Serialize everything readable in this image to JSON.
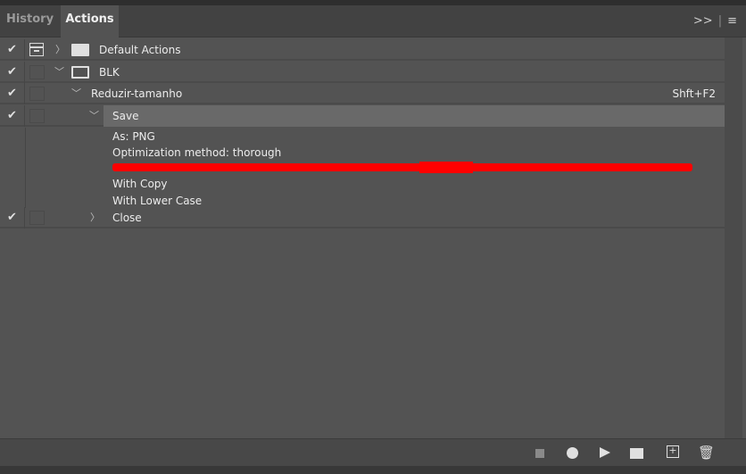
{
  "tabs": [
    {
      "label": "History"
    },
    {
      "label": "Actions"
    }
  ],
  "tab_controls": {
    "collapse": ">>",
    "menu": "≡"
  },
  "rows": [
    {
      "label": "Default Actions",
      "checked": true,
      "expanded": false
    },
    {
      "label": "BLK",
      "checked": true,
      "expanded": true
    },
    {
      "label": "Reduzir-tamanho",
      "checked": true,
      "expanded": true,
      "shortcut": "Shft+F2"
    },
    {
      "label": "Save",
      "checked": true,
      "expanded": true,
      "selected": true
    },
    {
      "label": "Close",
      "checked": true,
      "expanded": false
    }
  ],
  "save_details": [
    "As: PNG",
    "Optimization method: thorough",
    "With Copy",
    "With Lower Case"
  ],
  "colors": {
    "panel": "#535353",
    "selected": "#696969",
    "redaction": "#ff0000"
  },
  "bottom_icons": [
    "stop-icon",
    "record-icon",
    "play-icon",
    "new-set-icon",
    "new-action-icon",
    "trash-icon"
  ]
}
